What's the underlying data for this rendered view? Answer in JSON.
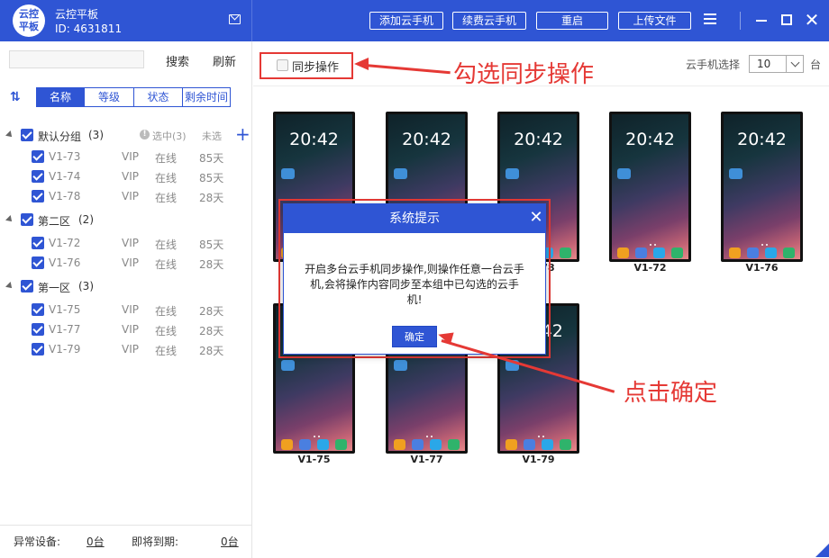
{
  "app": {
    "logo_text": "云控平板",
    "logo_line1": "云控",
    "logo_line2": "平板",
    "name": "云控平板",
    "id_label": "ID: 4631811"
  },
  "titlebar": {
    "buttons": [
      "添加云手机",
      "续费云手机",
      "重启",
      "上传文件"
    ],
    "close_glyph": "✕"
  },
  "sidebar": {
    "search_placeholder": "",
    "search_label": "搜索",
    "refresh_label": "刷新",
    "sort_tabs": [
      "名称",
      "等级",
      "状态",
      "剩余时间"
    ],
    "selected_label": "选中(3)",
    "unselected_label": "未选",
    "groups": [
      {
        "name": "默认分组",
        "count": "(3)",
        "devices": [
          {
            "name": "V1-73",
            "level": "VIP",
            "status": "在线",
            "days": "85天"
          },
          {
            "name": "V1-74",
            "level": "VIP",
            "status": "在线",
            "days": "85天"
          },
          {
            "name": "V1-78",
            "level": "VIP",
            "status": "在线",
            "days": "28天"
          }
        ]
      },
      {
        "name": "第二区",
        "count": "(2)",
        "devices": [
          {
            "name": "V1-72",
            "level": "VIP",
            "status": "在线",
            "days": "85天"
          },
          {
            "name": "V1-76",
            "level": "VIP",
            "status": "在线",
            "days": "28天"
          }
        ]
      },
      {
        "name": "第一区",
        "count": "(3)",
        "devices": [
          {
            "name": "V1-75",
            "level": "VIP",
            "status": "在线",
            "days": "28天"
          },
          {
            "name": "V1-77",
            "level": "VIP",
            "status": "在线",
            "days": "28天"
          },
          {
            "name": "V1-79",
            "level": "VIP",
            "status": "在线",
            "days": "28天"
          }
        ]
      }
    ],
    "footer": {
      "abnormal_label": "异常设备:",
      "abnormal_value": "0台",
      "expiring_label": "即将到期:",
      "expiring_value": "0台"
    }
  },
  "main": {
    "sync_label": "同步操作",
    "annotation_sync": "勾选同步操作",
    "annotation_ok": "点击确定",
    "phone_select_label": "云手机选择",
    "phone_select_value": "10",
    "phone_select_unit": "台",
    "phones": [
      {
        "label": "V1-73",
        "time": "20:42"
      },
      {
        "label": "V1-74",
        "time": "20:42"
      },
      {
        "label": "V1-78",
        "time": "20:42"
      },
      {
        "label": "V1-72",
        "time": "20:42"
      },
      {
        "label": "V1-76",
        "time": "20:42"
      },
      {
        "label": "V1-75",
        "time": "20:42"
      },
      {
        "label": "V1-77",
        "time": "20:42"
      },
      {
        "label": "V1-79",
        "time": "20:42"
      }
    ]
  },
  "dialog": {
    "title": "系统提示",
    "close_glyph": "✕",
    "message": "开启多台云手机同步操作,则操作任意一台云手机,会将操作内容同步至本组中已勾选的云手机!",
    "ok_label": "确定"
  },
  "colors": {
    "brand": "#2f55d4",
    "annotation": "#e53935"
  }
}
